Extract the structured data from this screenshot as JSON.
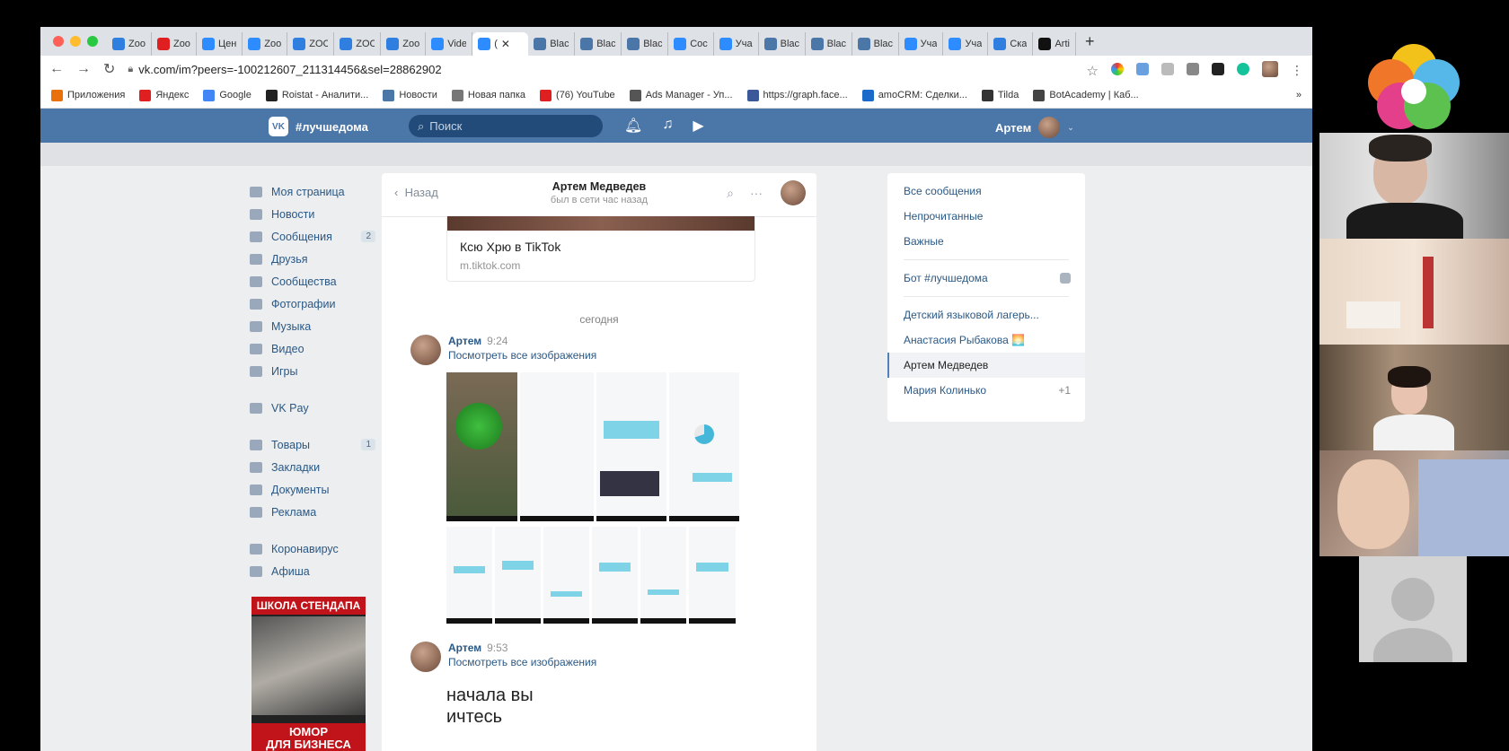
{
  "browser": {
    "tabs": [
      {
        "label": "Zoo",
        "icon": "app-store-icon",
        "color": "#2f7fe0"
      },
      {
        "label": "Zoo",
        "icon": "yandex-icon",
        "color": "#e02020"
      },
      {
        "label": "Цен",
        "icon": "zoom-icon",
        "color": "#2d8cff"
      },
      {
        "label": "Zoo",
        "icon": "zoom-icon",
        "color": "#2d8cff"
      },
      {
        "label": "ZOC",
        "icon": "app-store-icon",
        "color": "#2f7fe0"
      },
      {
        "label": "ZOC",
        "icon": "app-store-icon",
        "color": "#2f7fe0"
      },
      {
        "label": "Zoo",
        "icon": "app-store-icon",
        "color": "#2f7fe0"
      },
      {
        "label": "Vide",
        "icon": "zoom-icon",
        "color": "#2d8cff"
      },
      {
        "label": "(",
        "icon": "zoom-icon",
        "color": "#2d8cff",
        "active": true
      },
      {
        "label": "Blac",
        "icon": "vk-icon",
        "color": "#4a76a8"
      },
      {
        "label": "Blac",
        "icon": "vk-icon",
        "color": "#4a76a8"
      },
      {
        "label": "Blac",
        "icon": "vk-icon",
        "color": "#4a76a8"
      },
      {
        "label": "Coc",
        "icon": "zoom-icon",
        "color": "#2d8cff"
      },
      {
        "label": "Уча",
        "icon": "zoom-icon",
        "color": "#2d8cff"
      },
      {
        "label": "Blac",
        "icon": "vk-icon",
        "color": "#4a76a8"
      },
      {
        "label": "Blac",
        "icon": "vk-icon",
        "color": "#4a76a8"
      },
      {
        "label": "Blac",
        "icon": "vk-icon",
        "color": "#4a76a8"
      },
      {
        "label": "Уча",
        "icon": "zoom-icon",
        "color": "#2d8cff"
      },
      {
        "label": "Уча",
        "icon": "zoom-icon",
        "color": "#2d8cff"
      },
      {
        "label": "Ска",
        "icon": "download-icon",
        "color": "#2f7fe0"
      },
      {
        "label": "Arti",
        "icon": "tiktok-icon",
        "color": "#111111"
      }
    ],
    "tab_close": "✕",
    "new_tab": "+",
    "url": "vk.com/im?peers=-100212607_211314456&sel=28862902",
    "bookmarks": [
      {
        "label": "Приложения",
        "icon": "apps-grid-icon",
        "color": "#e8710a"
      },
      {
        "label": "Яндекс",
        "icon": "yandex-icon",
        "color": "#e02020"
      },
      {
        "label": "Google",
        "icon": "google-icon",
        "color": "#4285f4"
      },
      {
        "label": "Roistat - Аналити...",
        "icon": "roistat-icon",
        "color": "#222222"
      },
      {
        "label": "Новости",
        "icon": "vk-icon",
        "color": "#4a76a8"
      },
      {
        "label": "Новая папка",
        "icon": "folder-icon",
        "color": "#777777"
      },
      {
        "label": "(76) YouTube",
        "icon": "youtube-icon",
        "color": "#e02020"
      },
      {
        "label": "Ads Manager - Уп...",
        "icon": "ads-manager-icon",
        "color": "#555555"
      },
      {
        "label": "https://graph.face...",
        "icon": "facebook-icon",
        "color": "#3b5998"
      },
      {
        "label": "amoCRM: Сделки...",
        "icon": "amocrm-icon",
        "color": "#1b6ac9"
      },
      {
        "label": "Tilda",
        "icon": "tilda-icon",
        "color": "#333333"
      },
      {
        "label": "BotAcademy | Каб...",
        "icon": "globe-icon",
        "color": "#444444"
      }
    ],
    "bookmarks_more": "»"
  },
  "vk": {
    "logo_text": "#лучшедома",
    "logo_mark": "VK",
    "search_placeholder": "Поиск",
    "user_name": "Артем",
    "left_nav": [
      {
        "label": "Моя страница",
        "icon": "home-icon"
      },
      {
        "label": "Новости",
        "icon": "news-icon"
      },
      {
        "label": "Сообщения",
        "icon": "messages-icon",
        "count": "2"
      },
      {
        "label": "Друзья",
        "icon": "friends-icon"
      },
      {
        "label": "Сообщества",
        "icon": "communities-icon"
      },
      {
        "label": "Фотографии",
        "icon": "camera-icon"
      },
      {
        "label": "Музыка",
        "icon": "music-icon"
      },
      {
        "label": "Видео",
        "icon": "video-icon"
      },
      {
        "label": "Игры",
        "icon": "gamepad-icon"
      }
    ],
    "left_nav2": [
      {
        "label": "VK Pay",
        "icon": "vkpay-icon"
      }
    ],
    "left_nav3": [
      {
        "label": "Товары",
        "icon": "bag-icon",
        "count": "1"
      },
      {
        "label": "Закладки",
        "icon": "star-icon"
      },
      {
        "label": "Документы",
        "icon": "document-icon"
      },
      {
        "label": "Реклама",
        "icon": "megaphone-icon"
      }
    ],
    "left_nav4": [
      {
        "label": "Коронавирус",
        "icon": "virus-icon"
      },
      {
        "label": "Афиша",
        "icon": "poster-icon"
      }
    ],
    "ad": {
      "top": "ШКОЛА СТЕНДАПА",
      "bottom1": "ЮМОР",
      "bottom2": "ДЛЯ БИЗНЕСА"
    }
  },
  "chat": {
    "back": "Назад",
    "title": "Артем Медведев",
    "subtitle": "был в сети час назад",
    "link_title": "Ксю Хрю в TikTok",
    "link_url": "m.tiktok.com",
    "date_sep": "сегодня",
    "messages": [
      {
        "author": "Артем",
        "time": "9:24",
        "link": "Посмотреть все изображения"
      },
      {
        "author": "Артем",
        "time": "9:53",
        "link": "Посмотреть все изображения"
      }
    ],
    "big_text_1": "начала вы",
    "big_text_2": "ичтесь"
  },
  "right_panel": {
    "items": [
      {
        "label": "Все сообщения"
      },
      {
        "label": "Непрочитанные"
      },
      {
        "label": "Важные"
      }
    ],
    "bot": {
      "label": "Бот #лучшедома"
    },
    "dialogs": [
      {
        "label": "Детский языковой лагерь..."
      },
      {
        "label": "Анастасия Рыбакова 🌅"
      },
      {
        "label": "Артем Медведев",
        "selected": true
      },
      {
        "label": "Мария Колинько",
        "extra": "+1"
      }
    ]
  }
}
